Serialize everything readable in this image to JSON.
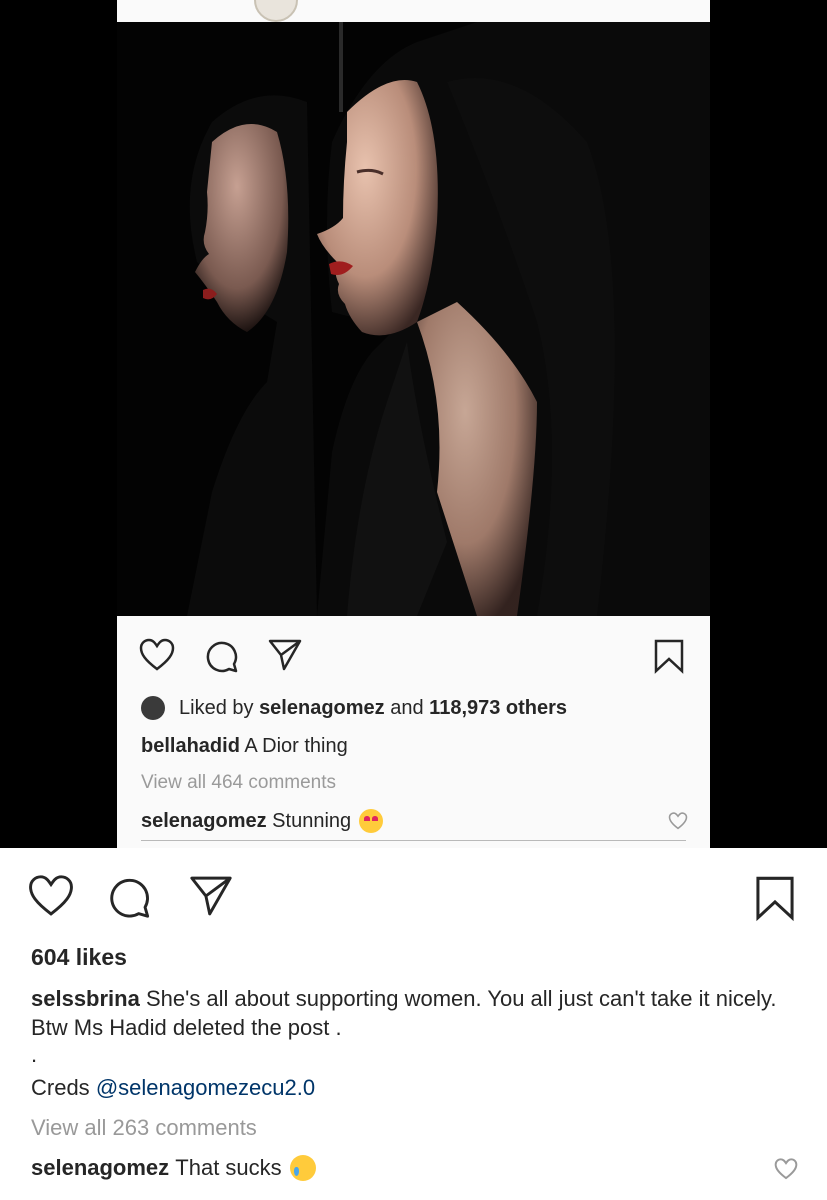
{
  "repost": {
    "likes_line": {
      "prefix": "Liked by",
      "user": "selenagomez",
      "joiner": "and",
      "others": "118,973 others"
    },
    "caption": {
      "user": "bellahadid",
      "text": "A Dior thing"
    },
    "view_all": "View all 464 comments",
    "comment": {
      "user": "selenagomez",
      "text": "Stunning"
    }
  },
  "post": {
    "likes": "604 likes",
    "caption": {
      "user": "selssbrina",
      "text": "She's all about supporting women. You all just can't take it nicely. Btw Ms Hadid deleted the post ."
    },
    "dot": ".",
    "creds_label": "Creds",
    "creds_mention": "@selenagomezecu2.0",
    "view_all": "View all 263 comments",
    "comment": {
      "user": "selenagomez",
      "text": "That sucks"
    }
  },
  "icons": {
    "like": "heart-icon",
    "comment": "comment-icon",
    "share": "send-icon",
    "save": "bookmark-icon"
  },
  "colors": {
    "mention": "#003569",
    "muted": "#999999",
    "text": "#262626"
  }
}
